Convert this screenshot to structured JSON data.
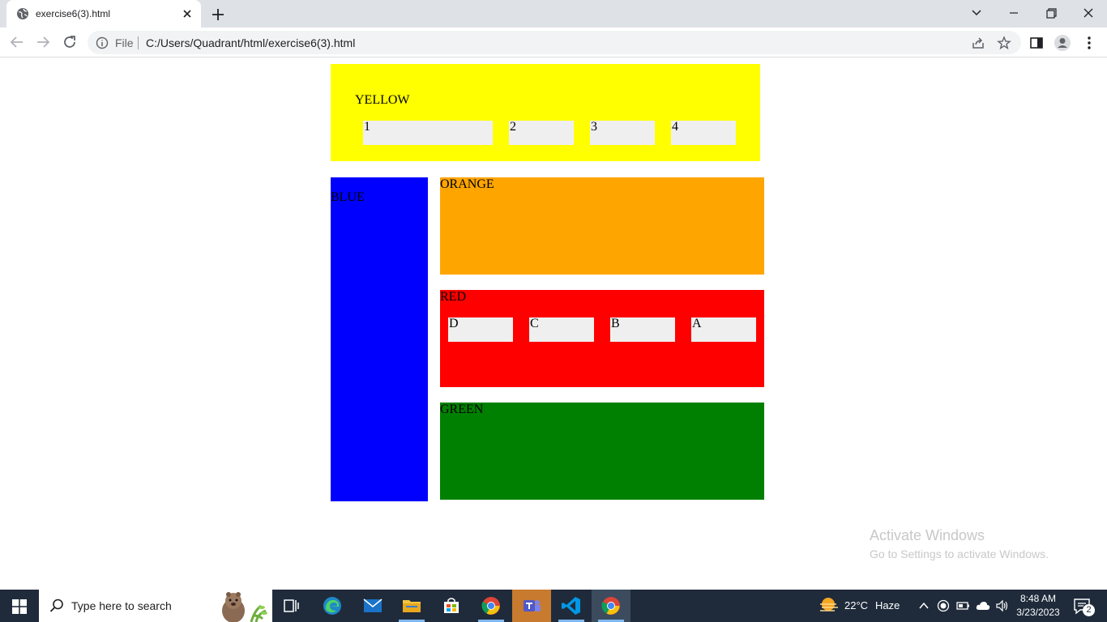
{
  "browser": {
    "tab_title": "exercise6(3).html",
    "scheme": "File",
    "url": "C:/Users/Quadrant/html/exercise6(3).html"
  },
  "page": {
    "yellow": {
      "label": "YELLOW",
      "items": [
        "1",
        "2",
        "3",
        "4"
      ],
      "color": "#ffff00"
    },
    "blue": {
      "label": "BLUE",
      "color": "#0000ff"
    },
    "orange": {
      "label": "ORANGE",
      "color": "#ffa500"
    },
    "red": {
      "label": "RED",
      "items": [
        "D",
        "C",
        "B",
        "A"
      ],
      "color": "#ff0000"
    },
    "green": {
      "label": "GREEN",
      "color": "#008000"
    }
  },
  "watermark": {
    "title": "Activate Windows",
    "subtitle": "Go to Settings to activate Windows."
  },
  "taskbar": {
    "search_placeholder": "Type here to search",
    "weather_temp": "22°C",
    "weather_desc": "Haze",
    "time": "8:48 AM",
    "date": "3/23/2023",
    "notification_count": "2"
  },
  "colors": {
    "tabstrip": "#dee1e6",
    "taskbar": "#1f2b3b",
    "cell": "#efefef"
  }
}
